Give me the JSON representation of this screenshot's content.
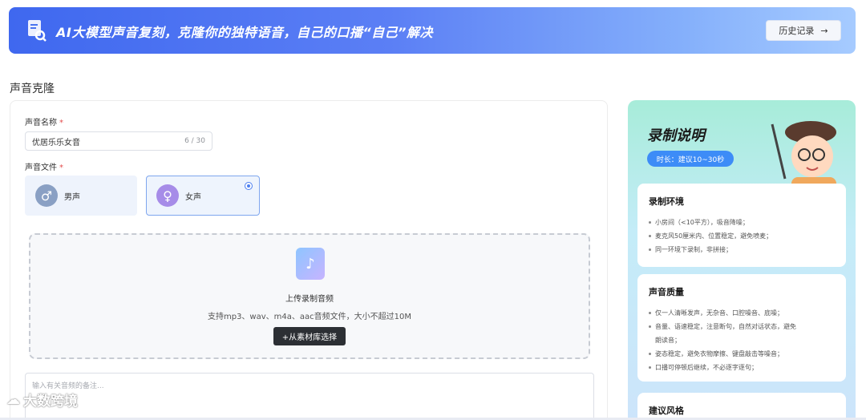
{
  "banner": {
    "title": "AI大模型声音复刻，克隆你的独特语音，自己的口播“自己”解决",
    "history_label": "历史记录",
    "history_arrow": "→"
  },
  "section_title": "声音克隆",
  "form": {
    "name_label": "声音名称",
    "required_mark": "*",
    "name_value": "优居乐乐女音",
    "name_count": "6 / 30",
    "file_label": "声音文件",
    "genders": [
      {
        "label": "男声",
        "symbol": "♂",
        "selected": false
      },
      {
        "label": "女声",
        "symbol": "♀",
        "selected": true
      }
    ],
    "upload": {
      "icon": "music-file-icon",
      "title": "上传录制音频",
      "desc": "支持mp3、wav、m4a、aac音频文件，大小不超过10M",
      "library_button": "+从素材库选择"
    },
    "note_placeholder": "输入有关音频的备注..."
  },
  "guide": {
    "title": "录制说明",
    "duration": "时长：建议10~30秒",
    "env": {
      "title": "录制环境",
      "items": [
        "小房间（<10平方），吸音降噪；",
        "麦克风50厘米内、位置稳定，避免喷麦；",
        "同一环境下录制，非拼接；"
      ]
    },
    "quality": {
      "title": "声音质量",
      "items": [
        "仅一人清晰发声，无杂音、口腔噪音、底噪；",
        "音量、语速稳定，注意断句，自然对话状态，避免朗读音；",
        "姿态稳定，避免衣物摩擦、键盘敲击等噪音；",
        "口播可停顿后继续，不必逐字逐句；"
      ]
    },
    "style": {
      "title": "建议风格"
    }
  },
  "watermark": "大数跨境",
  "colors": {
    "accent": "#3d8cf7",
    "banner_start": "#3f68ef",
    "required": "#e34d4d"
  }
}
